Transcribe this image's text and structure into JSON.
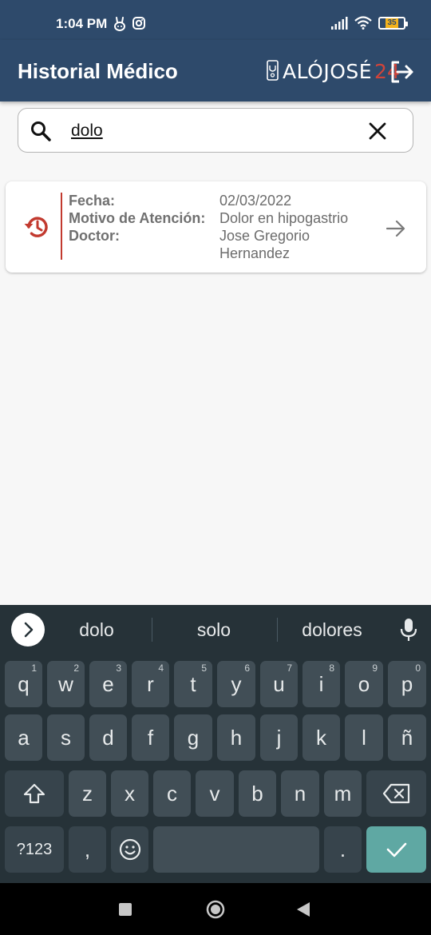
{
  "status_bar": {
    "time": "1:04 PM",
    "left_icons": [
      "bunny-notification-icon",
      "instagram-icon"
    ],
    "right_icons": [
      "signal-icon",
      "wifi-icon",
      "battery-icon"
    ],
    "battery_level": "35"
  },
  "app_bar": {
    "title": "Historial Médico",
    "brand_part1": "ALÓJOSÉ",
    "brand_part2": "24",
    "logout_icon": "logout-icon"
  },
  "search": {
    "value": "dolo",
    "icon": "search-icon",
    "clear_icon": "close-icon"
  },
  "records": [
    {
      "icon": "history-icon",
      "labels": {
        "date": "Fecha:",
        "reason": "Motivo de Atención:",
        "doctor": "Doctor:"
      },
      "date": "02/03/2022",
      "reason": "Dolor en hipogastrio",
      "doctor": "Jose Gregorio Hernandez",
      "action_icon": "arrow-right-icon"
    }
  ],
  "keyboard": {
    "suggestions": [
      "dolo",
      "solo",
      "dolores"
    ],
    "row1": [
      {
        "key": "q",
        "hint": "1"
      },
      {
        "key": "w",
        "hint": "2"
      },
      {
        "key": "e",
        "hint": "3"
      },
      {
        "key": "r",
        "hint": "4"
      },
      {
        "key": "t",
        "hint": "5"
      },
      {
        "key": "y",
        "hint": "6"
      },
      {
        "key": "u",
        "hint": "7"
      },
      {
        "key": "i",
        "hint": "8"
      },
      {
        "key": "o",
        "hint": "9"
      },
      {
        "key": "p",
        "hint": "0"
      }
    ],
    "row2": [
      "a",
      "s",
      "d",
      "f",
      "g",
      "h",
      "j",
      "k",
      "l",
      "ñ"
    ],
    "row3": [
      "z",
      "x",
      "c",
      "v",
      "b",
      "n",
      "m"
    ],
    "symbols_key": "?123",
    "comma_key": ",",
    "period_key": ".",
    "accent_color": "#5fa8a3"
  },
  "colors": {
    "primary": "#2e4a6b",
    "accent_red": "#c23a2f",
    "background": "#f7f7f7"
  }
}
